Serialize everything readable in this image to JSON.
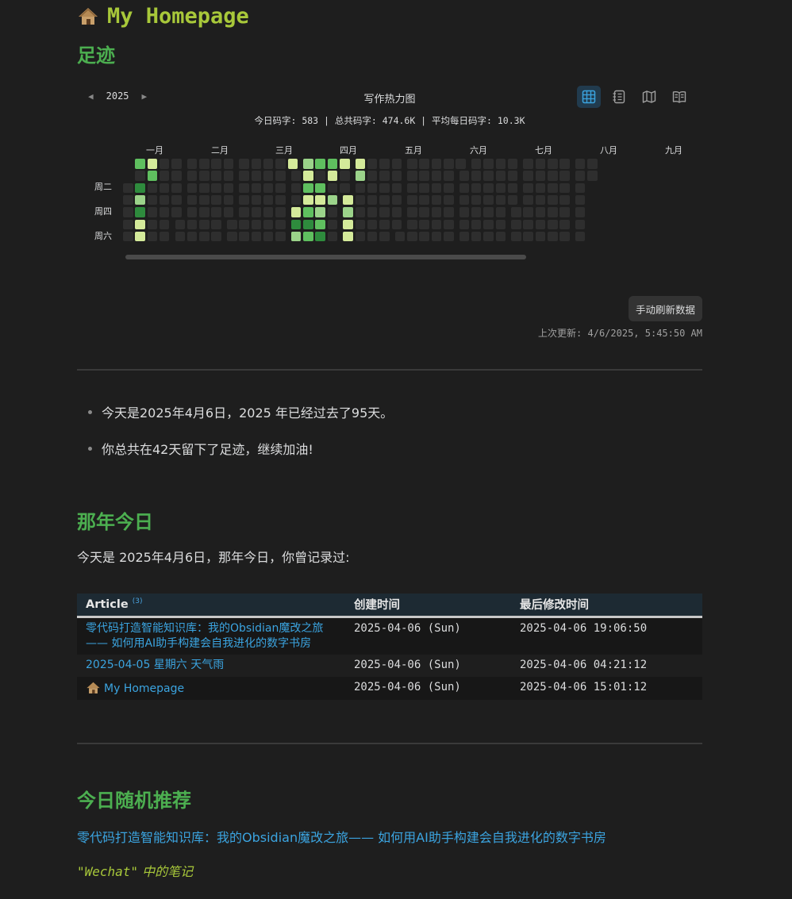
{
  "page_title": "My Homepage",
  "section_footprint": "足迹",
  "heatmap": {
    "year": "2025",
    "title": "写作热力图",
    "stats": "今日码字: 583 | 总共码字: 474.6K | 平均每日码字: 10.3K",
    "months": [
      "一月",
      "二月",
      "三月",
      "四月",
      "五月",
      "六月",
      "七月",
      "八月",
      "九月"
    ],
    "weekday_labels": [
      "周二",
      "周四",
      "周六"
    ],
    "view_icons": [
      "grid-view-icon",
      "notebook-icon",
      "map-icon",
      "book-icon"
    ],
    "colors": {
      "empty": "#2e2e2e",
      "level1": "#d4ea9a",
      "level2": "#9bd38a",
      "level3": "#5fbf5f",
      "level4": "#2e8b3d"
    },
    "day_levels": [
      0,
      0,
      0,
      0,
      0,
      3,
      0,
      4,
      2,
      4,
      1,
      1,
      1,
      3,
      0,
      0,
      0,
      0,
      0,
      0,
      0,
      0,
      0,
      0,
      0,
      0,
      0,
      0,
      0,
      0,
      0,
      0,
      0,
      0,
      0,
      0,
      0,
      0,
      0,
      0,
      0,
      0,
      0,
      0,
      0,
      0,
      0,
      0,
      0,
      0,
      0,
      0,
      0,
      0,
      0,
      0,
      0,
      0,
      0,
      0,
      0,
      0,
      0,
      0,
      0,
      0,
      0,
      0,
      0,
      0,
      0,
      0,
      0,
      0,
      0,
      0,
      0,
      0,
      0,
      0,
      0,
      0,
      0,
      0,
      0,
      0,
      0,
      0,
      0,
      1,
      0,
      0,
      0,
      1,
      4,
      2,
      2,
      1,
      3,
      1,
      3,
      4,
      3,
      3,
      0,
      3,
      1,
      2,
      3,
      4,
      3,
      1,
      0,
      2,
      0,
      0,
      0,
      1,
      0,
      0,
      1,
      2,
      1,
      1,
      1,
      2
    ]
  },
  "refresh_label": "手动刷新数据",
  "last_updated": "上次更新: 4/6/2025, 5:45:50 AM",
  "bullets": [
    "今天是2025年4月6日，2025 年已经过去了95天。",
    "你总共在42天留下了足迹，继续加油!"
  ],
  "section_onthisday": "那年今日",
  "onthisday_text": "今天是 2025年4月6日，那年今日，你曾记录过:",
  "table": {
    "headers": [
      "Article",
      "创建时间",
      "最后修改时间"
    ],
    "count": "(3)",
    "rows": [
      {
        "title_line1": "零代码打造智能知识库：我的Obsidian魔改之旅",
        "title_line2": "—— 如何用AI助手构建会自我进化的数字书房",
        "created": "2025-04-06 (Sun)",
        "modified": "2025-04-06 19:06:50"
      },
      {
        "title": "2025-04-05 星期六 天气雨",
        "created": "2025-04-06 (Sun)",
        "modified": "2025-04-06 04:21:12"
      },
      {
        "title": "My Homepage",
        "created": "2025-04-06 (Sun)",
        "modified": "2025-04-06 15:01:12"
      }
    ]
  },
  "section_random": "今日随机推荐",
  "random_link": "零代码打造智能知识库：我的Obsidian魔改之旅—— 如何用AI助手构建会自我进化的数字书房",
  "quote_word": "\"Wechat\"",
  "quote_rest": " 中的笔记"
}
